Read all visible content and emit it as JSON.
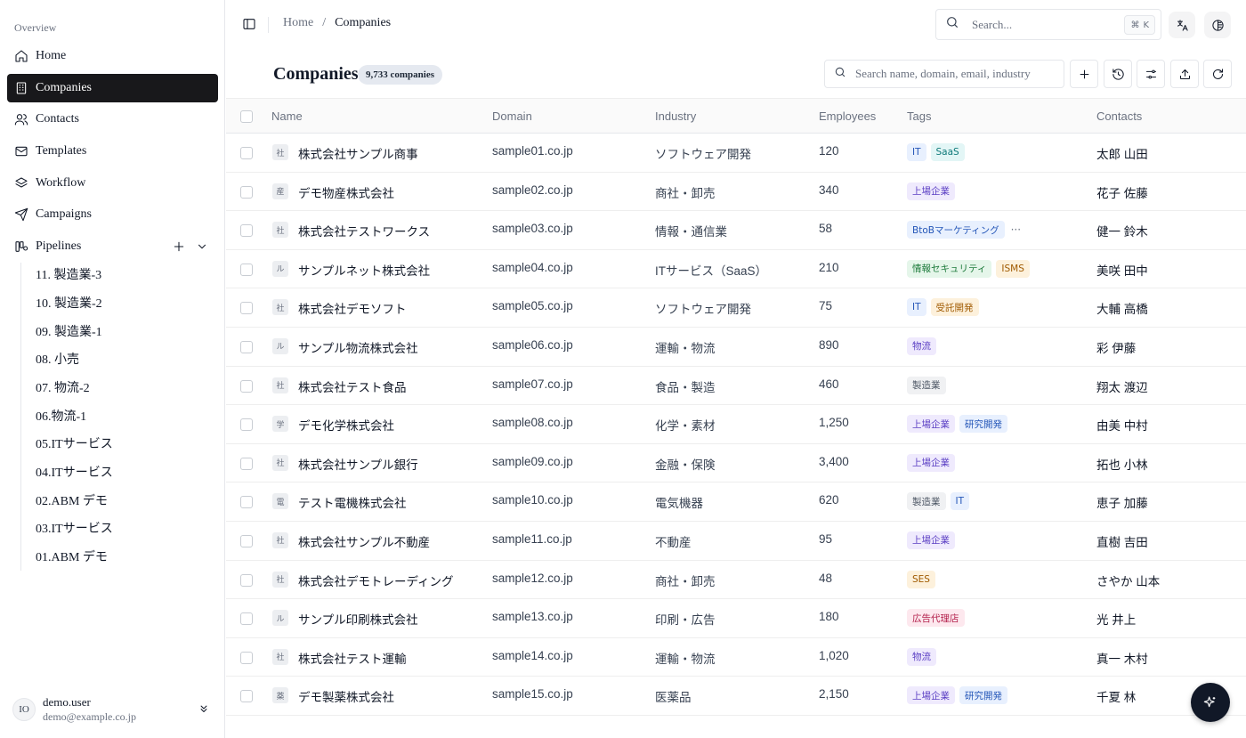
{
  "sidebar": {
    "section_label": "Overview",
    "nav": [
      {
        "label": "Home",
        "icon": "home-icon"
      },
      {
        "label": "Companies",
        "icon": "building-icon"
      },
      {
        "label": "Contacts",
        "icon": "users-icon"
      },
      {
        "label": "Templates",
        "icon": "mail-icon"
      },
      {
        "label": "Workflow",
        "icon": "layers-icon"
      },
      {
        "label": "Campaigns",
        "icon": "send-icon"
      },
      {
        "label": "Pipelines",
        "icon": "kanban-icon"
      }
    ],
    "active_item": "Companies",
    "pipelines": [
      "11. 製造業-3",
      "10. 製造業-2",
      "09. 製造業-1",
      "08. 小売",
      "07. 物流-2",
      "06.物流-1",
      "05.ITサービス",
      "04.ITサービス",
      "02.ABM デモ",
      "03.ITサービス",
      "01.ABM デモ"
    ],
    "user": {
      "initials": "IO",
      "name": "demo.user",
      "email": "demo@example.co.jp"
    }
  },
  "topbar": {
    "breadcrumb": {
      "home": "Home",
      "separator": "/",
      "current": "Companies"
    },
    "search_placeholder": "Search...",
    "shortcut": {
      "symbol": "⌘",
      "key": "K"
    }
  },
  "page": {
    "title": "Companies",
    "count_badge": "9,733 companies",
    "search_placeholder": "Search name, domain, email, industry"
  },
  "table": {
    "columns": {
      "name": "Name",
      "domain": "Domain",
      "industry": "Industry",
      "employees": "Employees",
      "tags": "Tags",
      "contacts": "Contacts"
    },
    "rows": [
      {
        "logo": "社",
        "name": "株式会社サンプル商事",
        "domain": "sample01.co.jp",
        "industry": "ソフトウェア開発",
        "employees": "120",
        "tags": [
          {
            "label": "IT",
            "tone": "blue"
          },
          {
            "label": "SaaS",
            "tone": "teal"
          }
        ],
        "more": false,
        "contact": "太郎 山田"
      },
      {
        "logo": "産",
        "name": "デモ物産株式会社",
        "domain": "sample02.co.jp",
        "industry": "商社・卸売",
        "employees": "340",
        "tags": [
          {
            "label": "上場企業",
            "tone": "purple"
          }
        ],
        "more": false,
        "contact": "花子 佐藤"
      },
      {
        "logo": "社",
        "name": "株式会社テストワークス",
        "domain": "sample03.co.jp",
        "industry": "情報・通信業",
        "employees": "58",
        "tags": [
          {
            "label": "BtoBマーケティング",
            "tone": "blue"
          }
        ],
        "more": true,
        "contact": "健一 鈴木"
      },
      {
        "logo": "ル",
        "name": "サンプルネット株式会社",
        "domain": "sample04.co.jp",
        "industry": "ITサービス（SaaS）",
        "employees": "210",
        "tags": [
          {
            "label": "情報セキュリティ",
            "tone": "green"
          },
          {
            "label": "ISMS",
            "tone": "orange"
          }
        ],
        "more": false,
        "contact": "美咲 田中"
      },
      {
        "logo": "社",
        "name": "株式会社デモソフト",
        "domain": "sample05.co.jp",
        "industry": "ソフトウェア開発",
        "employees": "75",
        "tags": [
          {
            "label": "IT",
            "tone": "blue"
          },
          {
            "label": "受託開発",
            "tone": "orange"
          }
        ],
        "more": false,
        "contact": "大輔 高橋"
      },
      {
        "logo": "ル",
        "name": "サンプル物流株式会社",
        "domain": "sample06.co.jp",
        "industry": "運輸・物流",
        "employees": "890",
        "tags": [
          {
            "label": "物流",
            "tone": "purple"
          }
        ],
        "more": false,
        "contact": "彩 伊藤"
      },
      {
        "logo": "社",
        "name": "株式会社テスト食品",
        "domain": "sample07.co.jp",
        "industry": "食品・製造",
        "employees": "460",
        "tags": [
          {
            "label": "製造業",
            "tone": "gray"
          }
        ],
        "more": false,
        "contact": "翔太 渡辺"
      },
      {
        "logo": "学",
        "name": "デモ化学株式会社",
        "domain": "sample08.co.jp",
        "industry": "化学・素材",
        "employees": "1,250",
        "tags": [
          {
            "label": "上場企業",
            "tone": "purple"
          },
          {
            "label": "研究開発",
            "tone": "blue"
          }
        ],
        "more": false,
        "contact": "由美 中村"
      },
      {
        "logo": "社",
        "name": "株式会社サンプル銀行",
        "domain": "sample09.co.jp",
        "industry": "金融・保険",
        "employees": "3,400",
        "tags": [
          {
            "label": "上場企業",
            "tone": "purple"
          }
        ],
        "more": false,
        "contact": "拓也 小林"
      },
      {
        "logo": "電",
        "name": "テスト電機株式会社",
        "domain": "sample10.co.jp",
        "industry": "電気機器",
        "employees": "620",
        "tags": [
          {
            "label": "製造業",
            "tone": "gray"
          },
          {
            "label": "IT",
            "tone": "blue"
          }
        ],
        "more": false,
        "contact": "恵子 加藤"
      },
      {
        "logo": "社",
        "name": "株式会社サンプル不動産",
        "domain": "sample11.co.jp",
        "industry": "不動産",
        "employees": "95",
        "tags": [
          {
            "label": "上場企業",
            "tone": "purple"
          }
        ],
        "more": false,
        "contact": "直樹 吉田"
      },
      {
        "logo": "社",
        "name": "株式会社デモトレーディング",
        "domain": "sample12.co.jp",
        "industry": "商社・卸売",
        "employees": "48",
        "tags": [
          {
            "label": "SES",
            "tone": "orange"
          }
        ],
        "more": false,
        "contact": "さやか 山本"
      },
      {
        "logo": "ル",
        "name": "サンプル印刷株式会社",
        "domain": "sample13.co.jp",
        "industry": "印刷・広告",
        "employees": "180",
        "tags": [
          {
            "label": "広告代理店",
            "tone": "pink"
          }
        ],
        "more": false,
        "contact": "光 井上"
      },
      {
        "logo": "社",
        "name": "株式会社テスト運輸",
        "domain": "sample14.co.jp",
        "industry": "運輸・物流",
        "employees": "1,020",
        "tags": [
          {
            "label": "物流",
            "tone": "purple"
          }
        ],
        "more": false,
        "contact": "真一 木村"
      },
      {
        "logo": "薬",
        "name": "デモ製薬株式会社",
        "domain": "sample15.co.jp",
        "industry": "医薬品",
        "employees": "2,150",
        "tags": [
          {
            "label": "上場企業",
            "tone": "purple"
          },
          {
            "label": "研究開発",
            "tone": "blue"
          }
        ],
        "more": false,
        "contact": "千夏 林"
      }
    ]
  },
  "tag_colors": {
    "blue": {
      "bg": "#e8f0fe",
      "fg": "#2456b8"
    },
    "teal": {
      "bg": "#e3f6f6",
      "fg": "#0f7a7a"
    },
    "purple": {
      "bg": "#efeafd",
      "fg": "#5b3fc4"
    },
    "green": {
      "bg": "#e5f6ea",
      "fg": "#1e7b3c"
    },
    "orange": {
      "bg": "#fdf1dc",
      "fg": "#a05a00"
    },
    "gray": {
      "bg": "#f0f1f3",
      "fg": "#4b5563"
    },
    "pink": {
      "bg": "#fde8ee",
      "fg": "#b4234e"
    }
  },
  "accent": {
    "active_nav_bg": "#18181b",
    "fab_bg": "#111827"
  }
}
